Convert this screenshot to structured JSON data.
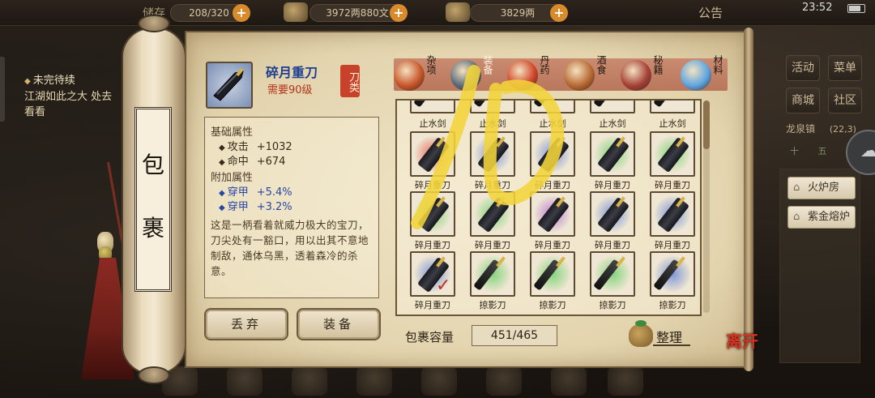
{
  "topbar": {
    "capacity_text": "208/320",
    "copper_text": "3972两880文",
    "gold_text": "3829两",
    "announcement": "公告",
    "clock": "23:52",
    "partial_label": "储存"
  },
  "quest": {
    "title": "未完待续",
    "text": "江湖如此之大 处去看看"
  },
  "right_menu": {
    "buttons": [
      "活动",
      "菜单",
      "商城",
      "社区"
    ],
    "location": "龙泉镇",
    "location_coords": "(22,3)",
    "sub_row": "十 五",
    "links": [
      "火炉房",
      "紫金熔炉"
    ]
  },
  "scroll": {
    "title_chars": [
      "包",
      "裹"
    ]
  },
  "item": {
    "name": "碎月重刀",
    "requirement": "需要90级",
    "type_tag": "刀类",
    "base_title": "基础属性",
    "base_stats": [
      {
        "name": "攻击",
        "value": "+1032"
      },
      {
        "name": "命中",
        "value": "+674"
      }
    ],
    "extra_title": "附加属性",
    "extra_stats": [
      {
        "name": "穿甲",
        "value": "+5.4%"
      },
      {
        "name": "穿甲",
        "value": "+3.2%"
      }
    ],
    "description": "这是一柄看着就威力极大的宝刀，刀尖处有一豁口，用以出其不意地制敌，通体乌黑，透着森冷的杀意。",
    "discard_label": "丢弃",
    "equip_label": "装备"
  },
  "categories": [
    {
      "label": "杂项",
      "color": "#c8562b",
      "active": false
    },
    {
      "label": "装备",
      "color": "#5a6a7a",
      "active": true
    },
    {
      "label": "丹药",
      "color": "#d0472a",
      "active": false
    },
    {
      "label": "酒食",
      "color": "#b86a34",
      "active": false
    },
    {
      "label": "秘籍",
      "color": "#a64238",
      "active": false
    },
    {
      "label": "材料",
      "color": "#5fa6e0",
      "active": false
    }
  ],
  "grid": {
    "top_row_labels": [
      "止水剑",
      "止水剑",
      "止水剑",
      "止水剑",
      "止水剑"
    ],
    "rows": [
      [
        {
          "label": "碎月重刀",
          "glow": "#e25a4a"
        },
        {
          "label": "碎月重刀",
          "glow": "#6b86d8"
        },
        {
          "label": "碎月重刀",
          "glow": "#6b86d8"
        },
        {
          "label": "碎月重刀",
          "glow": "#6fcf6a"
        },
        {
          "label": "碎月重刀",
          "glow": "#6fcf6a"
        }
      ],
      [
        {
          "label": "碎月重刀",
          "glow": "#6fcf6a"
        },
        {
          "label": "碎月重刀",
          "glow": "#6fcf6a"
        },
        {
          "label": "碎月重刀",
          "glow": "#b36bd3"
        },
        {
          "label": "碎月重刀",
          "glow": "#6b86d8"
        },
        {
          "label": "碎月重刀",
          "glow": "#6b86d8"
        }
      ],
      [
        {
          "label": "碎月重刀",
          "glow": "#6b86d8",
          "selected": true
        },
        {
          "label": "掠影刀",
          "glow": "#6fcf6a"
        },
        {
          "label": "掠影刀",
          "glow": "#6fcf6a"
        },
        {
          "label": "掠影刀",
          "glow": "#6fcf6a"
        },
        {
          "label": "掠影刀",
          "glow": "#6b86d8"
        }
      ]
    ]
  },
  "capacity": {
    "label": "包裹容量",
    "value": "451/465"
  },
  "sort_label": "整理",
  "leave_label": "离开",
  "colors": {
    "item_name": "#1e3f8f",
    "requirement": "#b3331f",
    "type_tag": "#c7412b",
    "extra_stat": "#2745a5",
    "scribble": "#f2d43a"
  }
}
